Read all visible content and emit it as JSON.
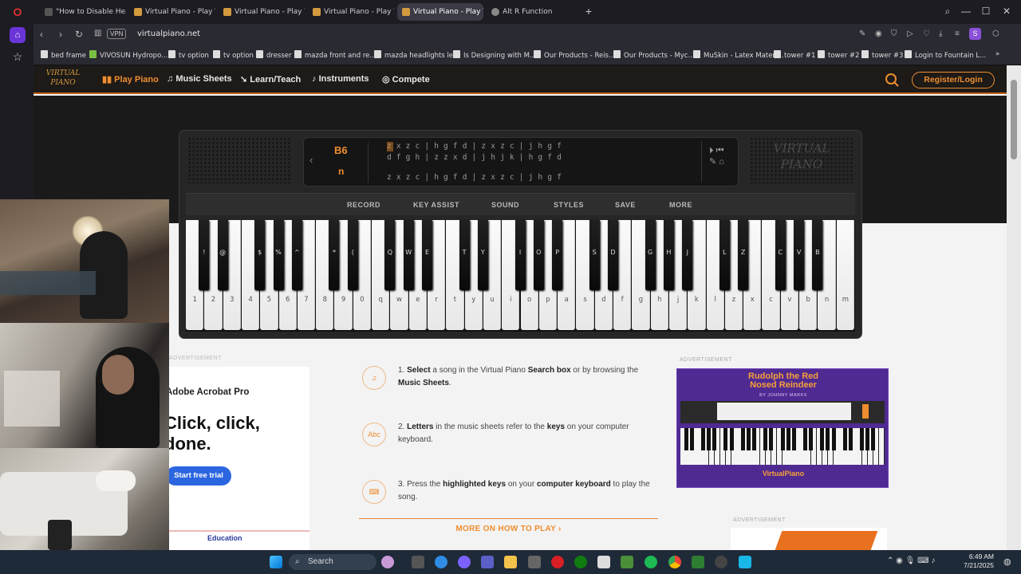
{
  "browser": {
    "tabs": [
      {
        "title": "\"How to Disable Heads-U",
        "active": false
      },
      {
        "title": "Virtual Piano - Play The Be",
        "active": false
      },
      {
        "title": "Virtual Piano - Play The Be",
        "active": false
      },
      {
        "title": "Virtual Piano - Play The Be",
        "active": false
      },
      {
        "title": "Virtual Piano - Play The B",
        "active": true
      },
      {
        "title": "Alt R Function",
        "active": false
      }
    ],
    "new_tab_label": "+",
    "url": "virtualpiano.net",
    "vpn_label": "VPN",
    "profile_initial": "S",
    "bookmarks": [
      "bed frame",
      "VIVOSUN Hydropo...",
      "tv option",
      "tv option",
      "dresser",
      "mazda front and re...",
      "mazda headlights le...",
      "Is Designing with M...",
      "Our Products - Reis...",
      "Our Products - Myc...",
      "MuSkin - Latex Materi...",
      "tower #1",
      "tower #2",
      "tower #3",
      "Login to Fountain L..."
    ]
  },
  "site": {
    "logo_text": "VIRTUAL PIANO",
    "nav": [
      {
        "label": "Play Piano",
        "active": true
      },
      {
        "label": "Music Sheets",
        "active": false
      },
      {
        "label": "Learn/Teach",
        "active": false
      },
      {
        "label": "Instruments",
        "active": false
      },
      {
        "label": "Compete",
        "active": false
      }
    ],
    "register_label": "Register/Login"
  },
  "piano": {
    "current_note": "B6",
    "current_key": "n",
    "sheet_lines": [
      "z x z c | h g f d | z x z c | j h g f",
      "d f g h | z z x d | j h j k | h g f d",
      "z x z c | h g f d | z x z c | j h g f"
    ],
    "logo_text": "VIRTUAL PIANO",
    "menu": [
      "RECORD",
      "KEY ASSIST",
      "SOUND",
      "STYLES",
      "SAVE",
      "MORE"
    ],
    "white_keys": [
      "1",
      "2",
      "3",
      "4",
      "5",
      "6",
      "7",
      "8",
      "9",
      "0",
      "q",
      "w",
      "e",
      "r",
      "t",
      "y",
      "u",
      "i",
      "o",
      "p",
      "a",
      "s",
      "d",
      "f",
      "g",
      "h",
      "j",
      "k",
      "l",
      "z",
      "x",
      "c",
      "v",
      "b",
      "n",
      "m"
    ],
    "black_keys": [
      "!",
      "@",
      "$",
      "%",
      "^",
      "*",
      "(",
      "Q",
      "W",
      "E",
      "T",
      "Y",
      "I",
      "O",
      "P",
      "S",
      "D",
      "G",
      "H",
      "J",
      "L",
      "Z",
      "C",
      "V",
      "B"
    ]
  },
  "instructions": [
    {
      "icon": "music-notes",
      "parts": [
        [
          "1. ",
          false
        ],
        [
          "Select",
          true
        ],
        [
          " a song in the Virtual Piano ",
          false
        ],
        [
          "Search box",
          true
        ],
        [
          " or by browsing the ",
          false
        ],
        [
          "Music Sheets",
          true
        ],
        [
          ".",
          false
        ]
      ]
    },
    {
      "icon": "abc",
      "parts": [
        [
          "2. ",
          false
        ],
        [
          "Letters",
          true
        ],
        [
          " in the music sheets refer to the ",
          false
        ],
        [
          "keys",
          true
        ],
        [
          " on your computer keyboard.",
          false
        ]
      ]
    },
    {
      "icon": "keyboard",
      "parts": [
        [
          "3. Press the ",
          false
        ],
        [
          "highlighted keys",
          true
        ],
        [
          " on your ",
          false
        ],
        [
          "computer keyboard",
          true
        ],
        [
          " to play the song.",
          false
        ]
      ]
    }
  ],
  "more_how_label": "MORE ON HOW TO PLAY",
  "ads": {
    "label": "ADVERTISEMENT",
    "adobe_brand": "Adobe Acrobat Pro",
    "adobe_headline_1": "Click, click,",
    "adobe_headline_2": "done.",
    "adobe_cta": "Start free trial",
    "adobe_footer": "Education",
    "rudolph_title_1": "Rudolph the Red",
    "rudolph_title_2": "Nosed Reindeer",
    "rudolph_by": "BY JOHNNY MARKS",
    "rudolph_footer": "VirtualPiano"
  },
  "taskbar": {
    "search_label": "Search",
    "time": "6:49 AM",
    "date": "7/21/2025"
  },
  "colors": {
    "accent": "#ee8d2f",
    "header_bg": "#1d1a17",
    "taskbar_bg": "#1f2a38",
    "ad_purple": "#5a2fa0"
  }
}
